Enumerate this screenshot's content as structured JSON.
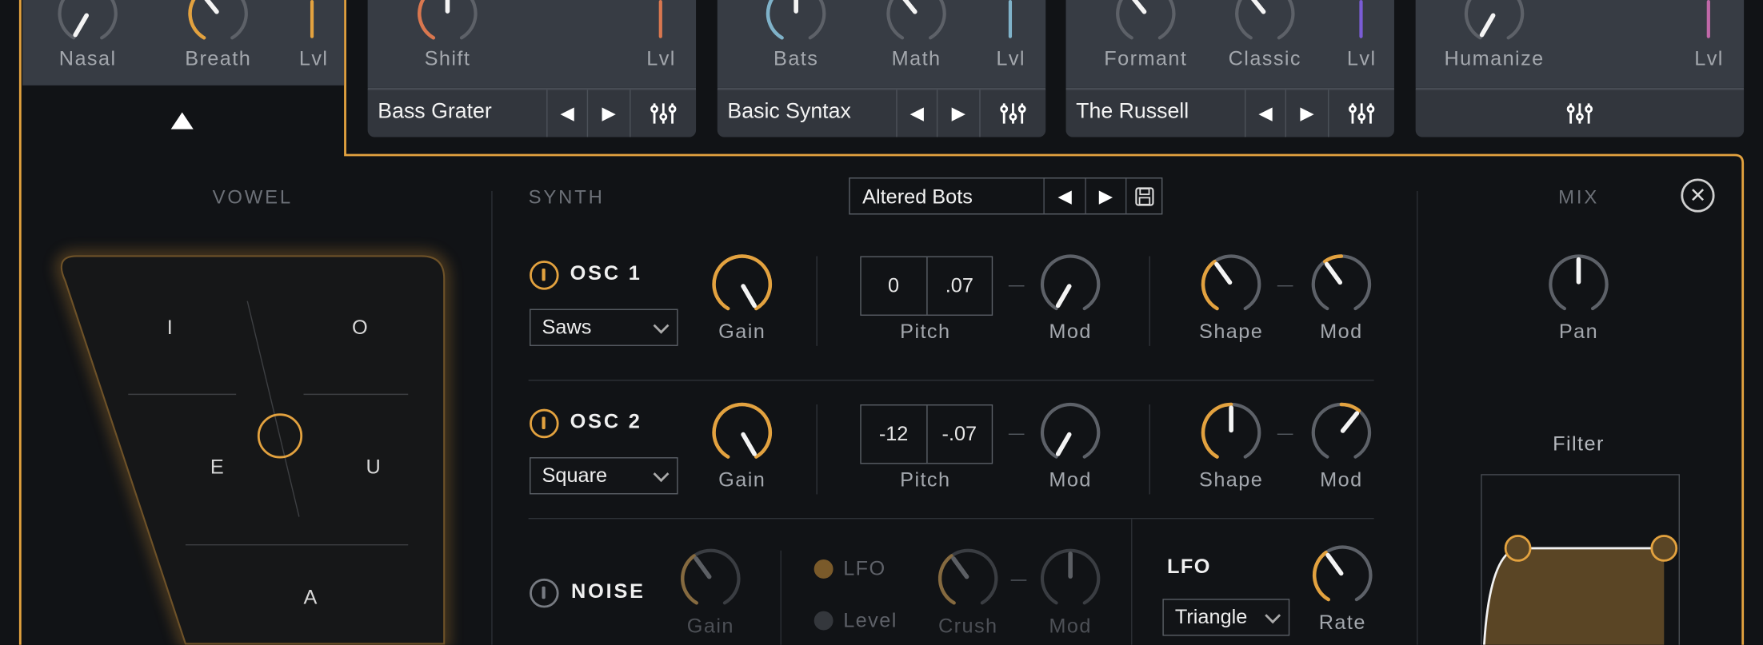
{
  "colors": {
    "accent": "#e3a23f",
    "shift": "#d9774f",
    "bats": "#7fb2c9",
    "formant": "#7a5cd6",
    "humanize": "#c068a8",
    "track": "#5d6168"
  },
  "top": {
    "vowel_module": {
      "knobs": [
        {
          "label": "Nasal",
          "value": 0.0
        },
        {
          "label": "Breath",
          "value": 0.37,
          "color": "#e3a23f"
        }
      ],
      "level_label": "Lvl",
      "level_color": "#e3a23f",
      "collapse_icon": "triangle-up-icon"
    },
    "modules": [
      {
        "knobs": [
          {
            "label": "Shift",
            "value": 0.5,
            "color": "#d9774f"
          }
        ],
        "level_label": "Lvl",
        "level_color": "#d9774f",
        "preset": "Bass Grater"
      },
      {
        "knobs": [
          {
            "label": "Bats",
            "value": 0.5,
            "color": "#7fb2c9"
          },
          {
            "label": "Math",
            "value": 0.37
          }
        ],
        "level_label": "Lvl",
        "level_color": "#7fb2c9",
        "preset": "Basic Syntax"
      },
      {
        "knobs": [
          {
            "label": "Formant",
            "value": 0.37
          },
          {
            "label": "Classic",
            "value": 0.37
          }
        ],
        "level_label": "Lvl",
        "level_color": "#7a5cd6",
        "preset": "The Russell"
      },
      {
        "knobs": [
          {
            "label": "Humanize",
            "value": 0.0
          }
        ],
        "level_label": "Lvl",
        "level_color": "#c068a8",
        "preset": ""
      }
    ]
  },
  "vowel": {
    "title": "VOWEL",
    "letters": [
      "I",
      "O",
      "E",
      "U",
      "A"
    ]
  },
  "synth": {
    "title": "SYNTH",
    "preset": "Altered Bots",
    "osc1": {
      "name": "OSC 1",
      "enabled": true,
      "waveform": "Saws",
      "gain": {
        "label": "Gain",
        "value": 1.0
      },
      "pitch": {
        "label": "Pitch",
        "coarse": "0",
        "fine": ".07"
      },
      "pitch_mod": {
        "label": "Mod",
        "value": 0.0
      },
      "shape": {
        "label": "Shape",
        "value": 0.38
      },
      "shape_mod": {
        "label": "Mod",
        "value": 0.38
      }
    },
    "osc2": {
      "name": "OSC 2",
      "enabled": true,
      "waveform": "Square",
      "gain": {
        "label": "Gain",
        "value": 1.0
      },
      "pitch": {
        "label": "Pitch",
        "coarse": "-12",
        "fine": "-.07"
      },
      "pitch_mod": {
        "label": "Mod",
        "value": 0.0
      },
      "shape": {
        "label": "Shape",
        "value": 0.5
      },
      "shape_mod": {
        "label": "Mod",
        "value": 0.63
      }
    },
    "noise": {
      "name": "NOISE",
      "enabled": false,
      "gain": {
        "label": "Gain",
        "value": 0.38
      },
      "lfo_option": "LFO",
      "level_option": "Level",
      "crush": {
        "label": "Crush",
        "value": 0.38
      },
      "mod": {
        "label": "Mod",
        "value": 0.5
      }
    },
    "lfo": {
      "title": "LFO",
      "waveform": "Triangle",
      "rate": {
        "label": "Rate",
        "value": 0.38
      }
    }
  },
  "mix": {
    "title": "MIX",
    "pan": {
      "label": "Pan",
      "value": 0.5
    },
    "filter_label": "Filter"
  }
}
